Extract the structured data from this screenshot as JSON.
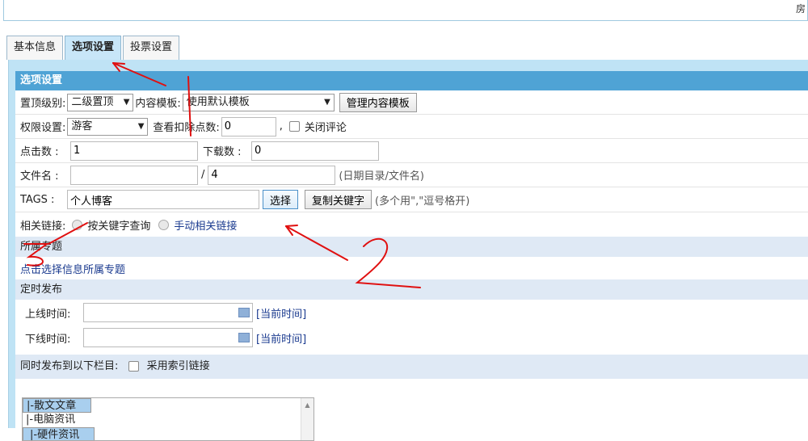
{
  "topbar": {
    "corner_text": "房"
  },
  "tabs": [
    {
      "label": "基本信息",
      "active": false
    },
    {
      "label": "选项设置",
      "active": true
    },
    {
      "label": "投票设置",
      "active": false
    }
  ],
  "section_header": "选项设置",
  "row_top": {
    "level_label": "置顶级别:",
    "level_value": "二级置顶",
    "template_label": "内容模板:",
    "template_value": "使用默认模板",
    "manage_template_button": "管理内容模板"
  },
  "row_permission": {
    "permission_label": "权限设置:",
    "permission_value": "游客",
    "points_label": "查看扣除点数:",
    "points_value": "0",
    "comma": ",",
    "close_comment_label": "关闭评论"
  },
  "row_counts": {
    "clicks_label": "点击数 :",
    "clicks_value": "1",
    "downloads_label": "下载数 :",
    "downloads_value": "0"
  },
  "row_filename": {
    "label": "文件名 :",
    "dir_value": "",
    "slash": "/",
    "file_value": "4",
    "hint": "(日期目录/文件名)"
  },
  "row_tags": {
    "label": "TAGS :",
    "value": "个人博客",
    "select_button": "选择",
    "copy_keywords_button": "复制关键字",
    "hint": "(多个用\",\"逗号格开)"
  },
  "row_related": {
    "label": "相关链接:",
    "option1": "按关键字查询",
    "option2": "手动相关链接"
  },
  "special": {
    "section_label": "所属专题",
    "link": "点击选择信息所属专题"
  },
  "schedule": {
    "section_label": "定时发布",
    "online_label": "上线时间:",
    "online_value": "",
    "offline_label": "下线时间:",
    "offline_value": "",
    "current_time_link": "[当前时间]"
  },
  "publish": {
    "label": "同时发布到以下栏目:",
    "index_link_label": "采用索引链接",
    "columns": [
      {
        "label": "|-散文文章",
        "selected": true
      },
      {
        "label": "|-电脑资讯",
        "selected": false
      },
      {
        "label": " |-硬件资讯",
        "selected": true
      }
    ]
  },
  "annotations": {
    "two": "2",
    "three": "3"
  }
}
